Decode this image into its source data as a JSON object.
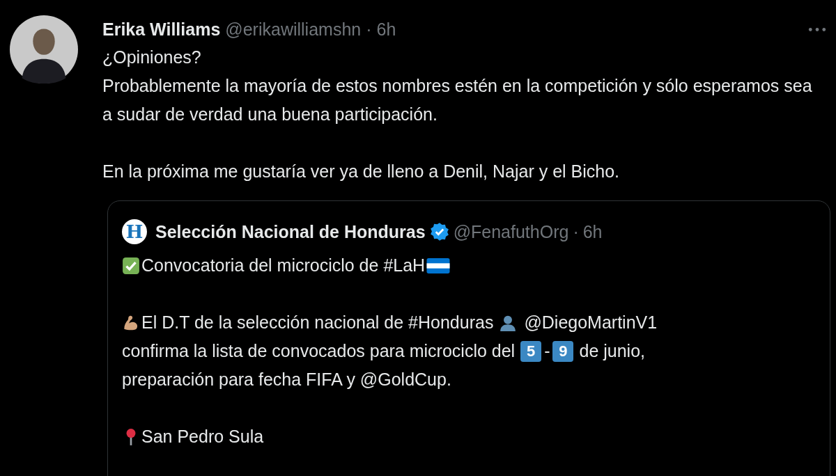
{
  "tweet": {
    "name": "Erika Williams",
    "handle": "@erikawilliamshn",
    "separator": "·",
    "time": "6h",
    "paragraphs": [
      "¿Opiniones?\nProbablemente la mayoría de estos nombres estén en la competición y sólo esperamos sea a sudar de verdad una buena participación.",
      "En la próxima me gustaría ver ya de lleno a Denil, Najar y el Bicho."
    ]
  },
  "quote": {
    "logo_letter": "H",
    "name": "Selección Nacional de Honduras",
    "verified": true,
    "handle": "@FenafuthOrg",
    "separator": "·",
    "time": "6h",
    "headline": "Convocatoria del microciclo de #LaH",
    "dt_line": {
      "text": "El D.T de la selección nacional de #Honduras",
      "mention": "@DiegoMartinV1"
    },
    "dates_line": {
      "before": "confirma la lista de convocados para microciclo del",
      "start": "5",
      "dash": "-",
      "end": "9",
      "after": "de junio,"
    },
    "prep_line": "preparación para fecha FIFA y @GoldCup.",
    "location": "San Pedro Sula"
  }
}
